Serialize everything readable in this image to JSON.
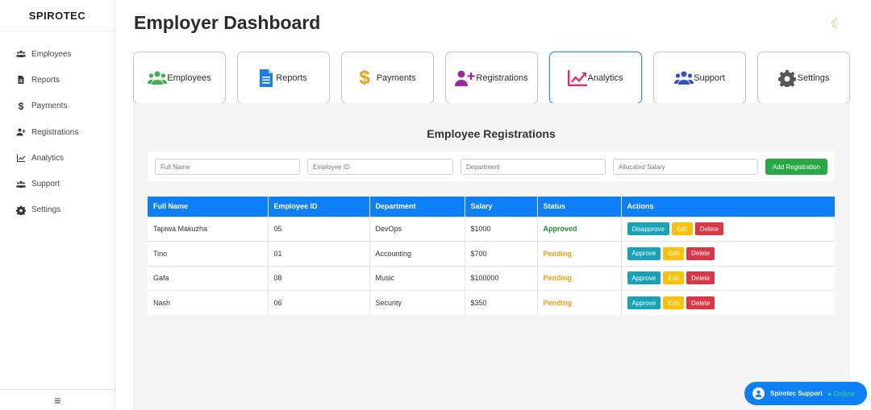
{
  "brand": "SPIROTEC",
  "sidebar": {
    "items": [
      {
        "label": "Employees",
        "icon": "users-icon"
      },
      {
        "label": "Reports",
        "icon": "file-icon"
      },
      {
        "label": "Payments",
        "icon": "dollar-icon"
      },
      {
        "label": "Registrations",
        "icon": "user-plus-icon"
      },
      {
        "label": "Analytics",
        "icon": "chart-line-icon"
      },
      {
        "label": "Support",
        "icon": "users-icon"
      },
      {
        "label": "Settings",
        "icon": "gear-icon"
      }
    ],
    "footer_icon": "≡"
  },
  "header": {
    "title": "Employer Dashboard",
    "theme_icon": "☾"
  },
  "cards": [
    {
      "label": "Employees",
      "icon": "users-icon",
      "color": "#3cb44b"
    },
    {
      "label": "Reports",
      "icon": "file-icon",
      "color": "#1f7fe0"
    },
    {
      "label": "Payments",
      "icon": "dollar-icon",
      "color": "#f0a00d"
    },
    {
      "label": "Registrations",
      "icon": "user-plus-icon",
      "color": "#9c2c9c"
    },
    {
      "label": "Analytics",
      "icon": "chart-line-icon",
      "color": "#d6336c",
      "active": true
    },
    {
      "label": "Support",
      "icon": "users-icon",
      "color": "#3a4fc4"
    },
    {
      "label": "Settings",
      "icon": "gear-icon",
      "color": "#555555"
    }
  ],
  "registrations": {
    "title": "Employee Registrations",
    "form": {
      "full_name_placeholder": "Full Name",
      "employee_id_placeholder": "Employee ID",
      "department_placeholder": "Department",
      "salary_placeholder": "Allocated Salary",
      "add_label": "Add Registration"
    },
    "columns": [
      "Full Name",
      "Employee ID",
      "Department",
      "Salary",
      "Status",
      "Actions"
    ],
    "rows": [
      {
        "name": "Tapiwa Makuzha",
        "id": "05",
        "dept": "DevOps",
        "salary": "$1000",
        "status": "Approved",
        "toggle": "Disapprove",
        "edit": "Edit",
        "delete": "Delete"
      },
      {
        "name": "Tino",
        "id": "01",
        "dept": "Accounting",
        "salary": "$700",
        "status": "Pending",
        "toggle": "Approve",
        "edit": "Edit",
        "delete": "Delete"
      },
      {
        "name": "Gafa",
        "id": "08",
        "dept": "Music",
        "salary": "$100000",
        "status": "Pending",
        "toggle": "Approve",
        "edit": "Edit",
        "delete": "Delete"
      },
      {
        "name": "Nash",
        "id": "06",
        "dept": "Security",
        "salary": "$350",
        "status": "Pending",
        "toggle": "Approve",
        "edit": "Edit",
        "delete": "Delete"
      }
    ]
  },
  "support_widget": {
    "label": "Spirotec Support",
    "status": "● Online"
  },
  "colors": {
    "primary": "#0d7ff9",
    "success": "#28a745",
    "approved": "#1f8c2c",
    "pending": "#f0a00d",
    "info": "#17a2b8",
    "warning": "#ffc107",
    "danger": "#dc3545"
  }
}
